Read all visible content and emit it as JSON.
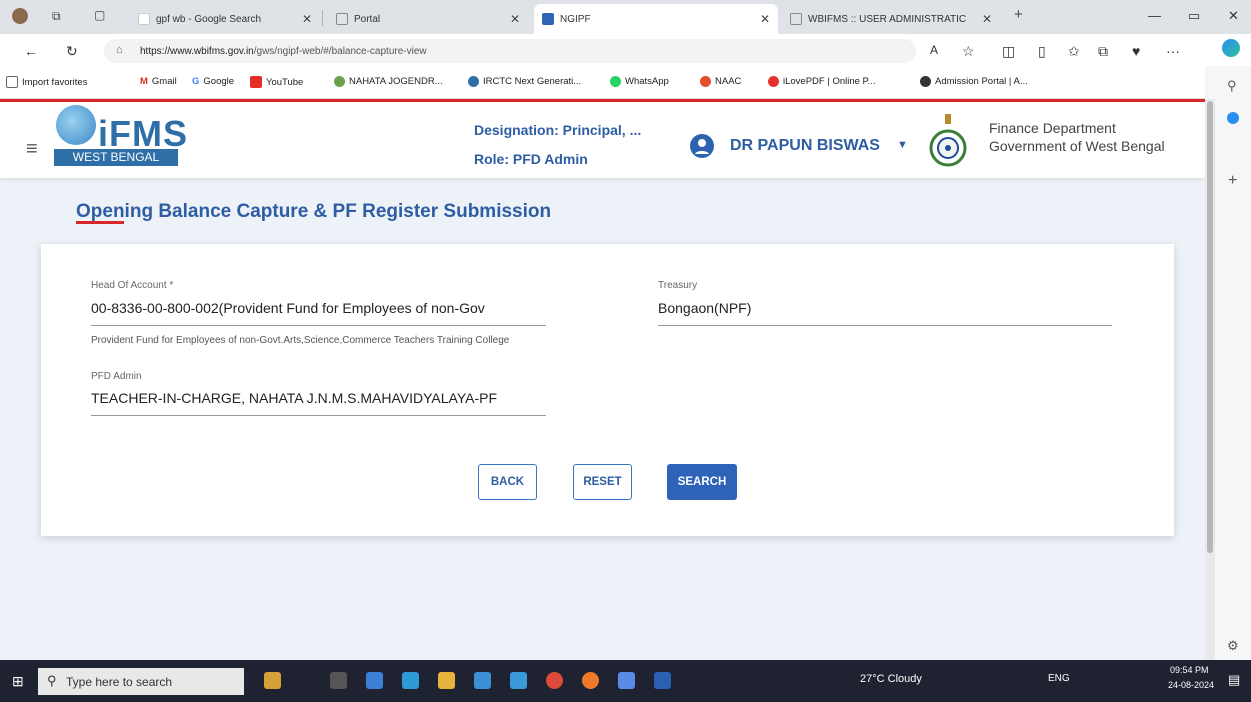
{
  "browser": {
    "tabs": [
      {
        "title": "gpf wb - Google Search"
      },
      {
        "title": "Portal"
      },
      {
        "title": "NGIPF"
      },
      {
        "title": "WBIFMS :: USER ADMINISTRATIC"
      }
    ],
    "url_host": "https://www.wbifms.gov.in",
    "url_path": "/gws/ngipf-web/#/balance-capture-view",
    "bookmarks": [
      "Import favorites",
      "Gmail",
      "Google",
      "YouTube",
      "NAHATA JOGENDR...",
      "IRCTC Next Generati...",
      "WhatsApp",
      "NAAC",
      "iLovePDF | Online P...",
      "Admission Portal | A..."
    ]
  },
  "header": {
    "logo_text": "iFMS",
    "logo_subtext": "WEST BENGAL",
    "designation": "Designation: Principal, ...",
    "role": "Role: PFD Admin",
    "user_name": "DR PAPUN BISWAS",
    "department_line1": "Finance Department",
    "department_line2": "Government of West Bengal"
  },
  "page_title": "Opening Balance Capture & PF Register Submission",
  "form": {
    "head_of_account_label": "Head Of Account *",
    "head_of_account_value": "00-8336-00-800-002(Provident Fund for Employees of non-Gov",
    "head_of_account_hint": "Provident Fund for Employees of non-Govt.Arts,Science,Commerce Teachers Training College",
    "treasury_label": "Treasury",
    "treasury_value": "Bongaon(NPF)",
    "pfd_admin_label": "PFD Admin",
    "pfd_admin_value": "TEACHER-IN-CHARGE, NAHATA J.N.M.S.MAHAVIDYALAYA-PF"
  },
  "buttons": {
    "back": "BACK",
    "reset": "RESET",
    "search": "SEARCH"
  },
  "taskbar": {
    "search_placeholder": "Type here to search",
    "weather": "27°C Cloudy",
    "lang": "ENG",
    "time": "09:54 PM",
    "date": "24-08-2024"
  },
  "colors": {
    "primary": "#2e63b8",
    "accent_red": "#d8262b",
    "page_bg": "#edf2f8"
  }
}
